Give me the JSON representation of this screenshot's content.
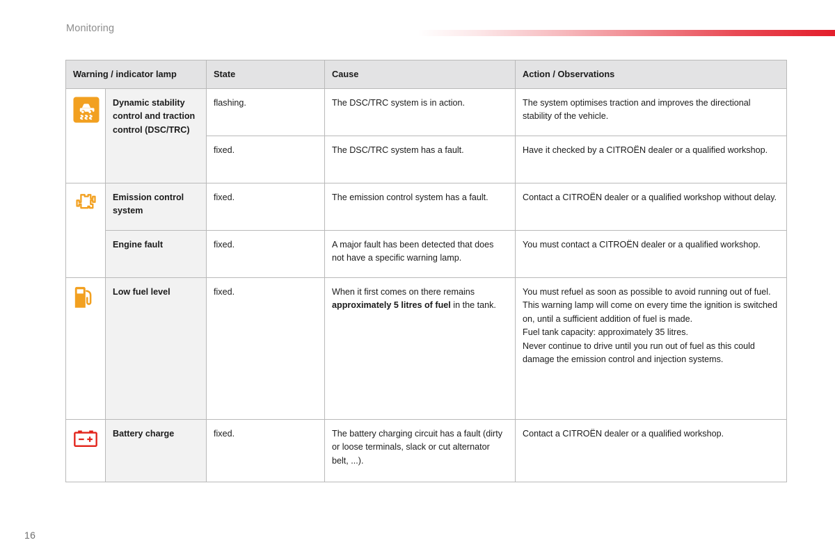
{
  "header": {
    "chapter_title": "Monitoring",
    "rule_color": "#e31e2b"
  },
  "table": {
    "columns": [
      {
        "key": "lamp",
        "label": "Warning / indicator lamp"
      },
      {
        "key": "state",
        "label": "State"
      },
      {
        "key": "cause",
        "label": "Cause"
      },
      {
        "key": "action",
        "label": "Action / Observations"
      }
    ],
    "rows": [
      {
        "icon": "dsc-trc-skid-car-icon",
        "icon_color": "#f2a020",
        "name": "Dynamic stability control and traction control (DSC/TRC)",
        "entries": [
          {
            "state": "flashing.",
            "cause": "The DSC/TRC system is in action.",
            "action": [
              "The system optimises traction and improves the directional stability of the vehicle."
            ]
          },
          {
            "state": "fixed.",
            "cause": "The DSC/TRC system has a fault.",
            "action": [
              "Have it checked by a CITROËN dealer or a qualified workshop."
            ]
          }
        ]
      },
      {
        "icon": "check-engine-icon",
        "icon_color": "#f2a020",
        "name": "Emission control system",
        "name2": "Engine fault",
        "entries": [
          {
            "state": "fixed.",
            "cause": "The emission control system has a fault.",
            "action": [
              "Contact a CITROËN dealer or a qualified workshop without delay."
            ]
          },
          {
            "state": "fixed.",
            "cause": "A major fault has been detected that does not have a specific warning lamp.",
            "action": [
              "You must contact a CITROËN dealer or a qualified workshop."
            ]
          }
        ]
      },
      {
        "icon": "fuel-pump-icon",
        "icon_color": "#f2a020",
        "name": "Low fuel level",
        "entries": [
          {
            "state": "fixed.",
            "cause_pre": "When it first comes on there remains ",
            "cause_bold": "approximately 5 litres of fuel",
            "cause_post": " in the tank.",
            "action": [
              "You must refuel as soon as possible to avoid running out of fuel.",
              "This warning lamp will come on every time the ignition is switched on, until a sufficient addition of fuel is made.",
              "Fuel tank capacity: approximately 35 litres.",
              "Never continue to drive until you run out of fuel as this could damage the emission control and injection systems."
            ]
          }
        ]
      },
      {
        "icon": "battery-charge-icon",
        "icon_color": "#e2231a",
        "name": "Battery charge",
        "entries": [
          {
            "state": "fixed.",
            "cause": "The battery charging circuit has a fault (dirty or loose terminals, slack or cut alternator belt, ...).",
            "action": [
              "Contact a CITROËN dealer or a qualified workshop."
            ]
          }
        ]
      }
    ]
  },
  "footer": {
    "page_number": "16"
  }
}
